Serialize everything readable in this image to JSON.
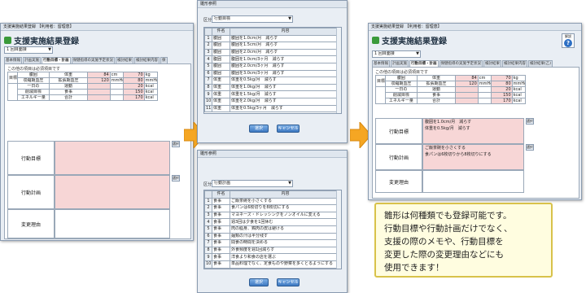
{
  "left_window": {
    "titlebar": "支援実施結果登録 【利用者：留理恵】",
    "form_title": "支援実施結果登録",
    "combo_value": "1 回目面接",
    "tabs": [
      "基本情報",
      "計画実施",
      "行動目標・計画",
      "保健指導の実施予定状況",
      "検討結果",
      "検討結果内容",
      "保"
    ],
    "note": "この他の項目は必須項目です",
    "table": {
      "rows": [
        {
          "g": "目標",
          "label": "腹囲",
          "cur": "体重",
          "val": "84",
          "unit": "cm",
          "val2": "70",
          "unit2": "kg"
        },
        {
          "g": "",
          "label": "収縮期血圧",
          "cur": "拡張期血圧",
          "val": "120",
          "unit": "mmHg",
          "val2": "80",
          "unit2": "mmHg"
        },
        {
          "g": "",
          "label": "一日の",
          "cur": "運動",
          "val": "",
          "unit": "",
          "val2": "20",
          "unit2": "kcal"
        },
        {
          "g": "",
          "label": "削減目標",
          "cur": "食事",
          "val": "",
          "unit": "",
          "val2": "150",
          "unit2": "kcal"
        },
        {
          "g": "",
          "label": "エネルギー量",
          "cur": "合計",
          "val": "",
          "unit": "",
          "val2": "170",
          "unit2": "kcal"
        }
      ]
    },
    "fields": [
      {
        "label": "行動目標",
        "text": "",
        "pink": true
      },
      {
        "label": "行動計画",
        "text": "",
        "pink": true
      },
      {
        "label": "変更理由",
        "text": "",
        "pink": false
      }
    ],
    "side_button": "選択"
  },
  "top_dialog": {
    "titlebar": "雛形参照",
    "filter_label": "区分",
    "filter_value": "行動目標",
    "header": [
      "件名",
      "内容"
    ],
    "rows": [
      [
        "1",
        "腹囲",
        "腹囲を1.0cm/月　減らす"
      ],
      [
        "2",
        "腹囲",
        "腹囲を1.5cm/月　減らす"
      ],
      [
        "3",
        "腹囲",
        "腹囲を2.0cm/月　減らす"
      ],
      [
        "4",
        "腹囲",
        "腹囲を1.0cm/3ヶ月　減らす"
      ],
      [
        "5",
        "腹囲",
        "腹囲を2.0cm/3ヶ月　減らす"
      ],
      [
        "6",
        "腹囲",
        "腹囲を3.0cm/3ヶ月　減らす"
      ],
      [
        "7",
        "体重",
        "体重を0.5kg/月　減らす"
      ],
      [
        "8",
        "体重",
        "体重を1.0kg/月　減らす"
      ],
      [
        "9",
        "体重",
        "体重を1.5kg/月　減らす"
      ],
      [
        "10",
        "体重",
        "体重を2.0kg/月　減らす"
      ],
      [
        "11",
        "体重",
        "体重を0.5kg/3ヶ月　減らす"
      ]
    ],
    "select_button": "選択",
    "cancel_button": "キャンセル"
  },
  "bottom_dialog": {
    "titlebar": "雛形参照",
    "filter_label": "区分",
    "filter_value": "行動計画",
    "header": [
      "件名",
      "内容"
    ],
    "rows": [
      [
        "1",
        "食事",
        "ご飯茶碗を小さくする"
      ],
      [
        "2",
        "食事",
        "食パンは6枚切りを8枚切にする"
      ],
      [
        "3",
        "食事",
        "マヨネーズ・ドレッシングをノンオイルに変える"
      ],
      [
        "4",
        "食事",
        "週3回は夕食を1回休む"
      ],
      [
        "5",
        "食事",
        "肉の脂身、鶏肉の皮は避ける"
      ],
      [
        "6",
        "食事",
        "麺類の汁は半分残す"
      ],
      [
        "7",
        "食事",
        "間食の時間を決める"
      ],
      [
        "8",
        "食事",
        "外食頻度を週1回減らす"
      ],
      [
        "9",
        "食事",
        "洋食より和食の店を選ぶ"
      ],
      [
        "10",
        "食事",
        "単品料理でなく、定食ものや野菜を多くとるようにする"
      ]
    ],
    "select_button": "選択",
    "cancel_button": "キャンセル"
  },
  "right_window": {
    "titlebar": "支援実施結果登録 【利用者：留理恵】",
    "form_title": "支援実施結果登録",
    "combo_value": "1 回目面接",
    "help_label": "解説",
    "tabs": [
      "基本情報",
      "計画実施",
      "行動目標・計画",
      "保健指導の実施予定状況",
      "検討結果",
      "検討結果内容",
      "検討結果(乙)"
    ],
    "note": "この他の項目は必須項目です",
    "table": {
      "rows": [
        {
          "g": "目標",
          "label": "腹囲",
          "cur": "体重",
          "val": "84",
          "unit": "cm",
          "val2": "70",
          "unit2": "kg"
        },
        {
          "g": "",
          "label": "収縮期血圧",
          "cur": "拡張期血圧",
          "val": "120",
          "unit": "mmHg",
          "val2": "80",
          "unit2": "mmHg"
        },
        {
          "g": "",
          "label": "一日の",
          "cur": "運動",
          "val": "",
          "unit": "",
          "val2": "20",
          "unit2": "kcal"
        },
        {
          "g": "",
          "label": "削減目標",
          "cur": "食事",
          "val": "",
          "unit": "",
          "val2": "150",
          "unit2": "kcal"
        },
        {
          "g": "",
          "label": "エネルギー量",
          "cur": "合計",
          "val": "",
          "unit": "",
          "val2": "170",
          "unit2": "kcal"
        }
      ]
    },
    "fields": [
      {
        "label": "行動目標",
        "text": "腹囲を1.0cm/月　減らす\n体重を0.5kg/月　減らす",
        "pink": true
      },
      {
        "label": "行動計画",
        "text": "ご飯茶碗を小さくする\n食パンは6枚切りから8枚切りにする",
        "pink": true
      },
      {
        "label": "変更理由",
        "text": "",
        "pink": false
      }
    ],
    "side_button": "選択"
  },
  "callout": {
    "lines": [
      "雛形は何種類でも登録可能です。",
      "行動目標や行動計画だけでなく、",
      "支援の際のメモや、行動目標を",
      "変更した際の変更理由などにも",
      "使用できます！"
    ]
  },
  "colors": {
    "required_field": "#f7d6d6",
    "arrow": "#f5a623",
    "callout_bg": "#fffde0"
  }
}
